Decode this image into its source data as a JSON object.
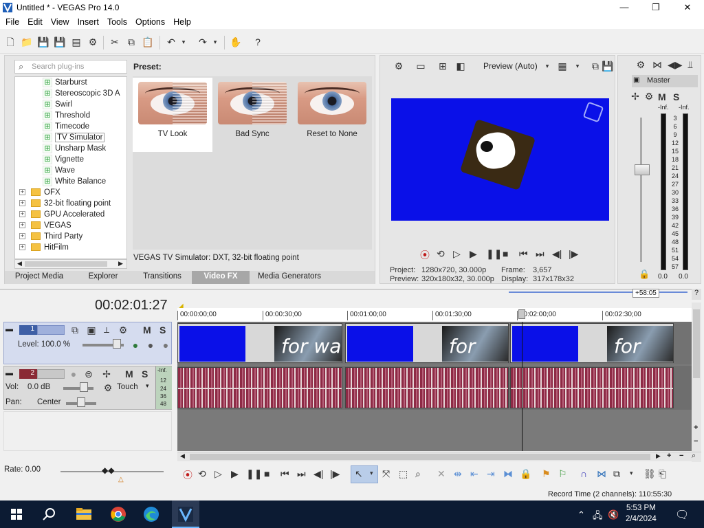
{
  "window": {
    "title": "Untitled * - VEGAS Pro 14.0",
    "min": "—",
    "max": "❐",
    "close": "✕"
  },
  "menu": [
    "File",
    "Edit",
    "View",
    "Insert",
    "Tools",
    "Options",
    "Help"
  ],
  "fx": {
    "search_placeholder": "Search plug-ins",
    "tree": [
      {
        "label": "Starburst",
        "type": "plugin"
      },
      {
        "label": "Stereoscopic 3D A",
        "type": "plugin"
      },
      {
        "label": "Swirl",
        "type": "plugin"
      },
      {
        "label": "Threshold",
        "type": "plugin"
      },
      {
        "label": "Timecode",
        "type": "plugin"
      },
      {
        "label": "TV Simulator",
        "type": "plugin",
        "selected": true
      },
      {
        "label": "Unsharp Mask",
        "type": "plugin"
      },
      {
        "label": "Vignette",
        "type": "plugin"
      },
      {
        "label": "Wave",
        "type": "plugin"
      },
      {
        "label": "White Balance",
        "type": "plugin"
      },
      {
        "label": "OFX",
        "type": "folder"
      },
      {
        "label": "32-bit floating point",
        "type": "folder"
      },
      {
        "label": "GPU Accelerated",
        "type": "folder"
      },
      {
        "label": "VEGAS",
        "type": "folder"
      },
      {
        "label": "Third Party",
        "type": "folder"
      },
      {
        "label": "HitFilm",
        "type": "folder"
      }
    ],
    "preset_label": "Preset:",
    "presets": [
      "TV Look",
      "Bad Sync",
      "Reset to None"
    ],
    "description": "VEGAS TV Simulator: DXT, 32-bit floating point",
    "tabs": [
      "Project Media",
      "Explorer",
      "Transitions",
      "Video FX",
      "Media Generators"
    ],
    "active_tab": "Video FX"
  },
  "preview": {
    "mode": "Preview (Auto)",
    "project_label": "Project:",
    "project_value": "1280x720, 30.000p",
    "preview_label": "Preview:",
    "preview_value": "320x180x32, 30.000p",
    "frame_label": "Frame:",
    "frame_value": "3,657",
    "display_label": "Display:",
    "display_value": "317x178x32"
  },
  "master": {
    "name": "Master",
    "scale": [
      "-Inf.",
      "3",
      "6",
      "9",
      "12",
      "15",
      "18",
      "21",
      "24",
      "27",
      "30",
      "33",
      "36",
      "39",
      "42",
      "45",
      "48",
      "51",
      "54",
      "57"
    ],
    "left_val": "0.0",
    "right_val": "0.0",
    "top_left": "-Inf.",
    "top_right": "-Inf."
  },
  "timeline": {
    "timecode": "00:02:01:27",
    "offset": "+58:05",
    "ruler": [
      "00:00:00;00",
      "00:00:30;00",
      "00:01:00;00",
      "00:01:30;00",
      "00:02:00;00",
      "00:02:30;00"
    ],
    "clip_text": "for wa"
  },
  "video_track": {
    "number": "1",
    "level": "Level: 100.0 %",
    "m": "M",
    "s": "S"
  },
  "audio_track": {
    "number": "2",
    "vol_label": "Vol:",
    "vol_value": "0.0 dB",
    "pan_label": "Pan:",
    "pan_value": "Center",
    "mode": "Touch",
    "m": "M",
    "s": "S",
    "meter": [
      "-Inf.",
      "12",
      "24",
      "36",
      "48"
    ]
  },
  "rate": "Rate: 0.00",
  "status": {
    "record_time": "Record Time (2 channels): 110:55:30"
  },
  "taskbar": {
    "time": "5:53 PM",
    "date": "2/4/2024"
  },
  "colors": {
    "accent": "#0a10e8",
    "audio_wave": "#8e2a45",
    "taskbar": "#0c1b33"
  }
}
